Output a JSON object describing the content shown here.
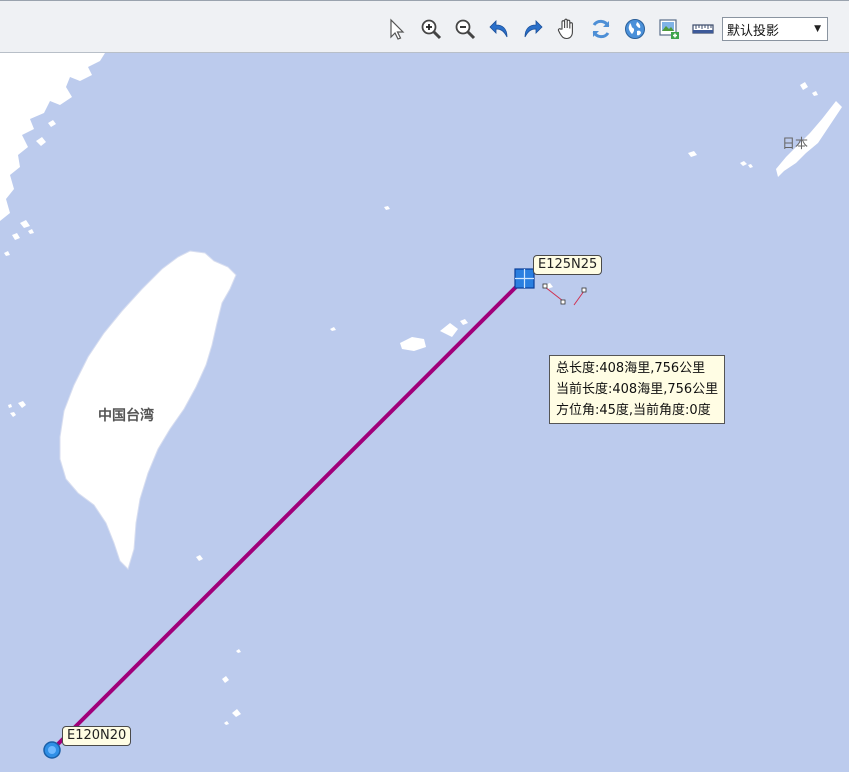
{
  "toolbar": {
    "tools": [
      {
        "name": "select-arrow-icon"
      },
      {
        "name": "zoom-in-icon"
      },
      {
        "name": "zoom-out-icon"
      },
      {
        "name": "undo-icon"
      },
      {
        "name": "redo-icon"
      },
      {
        "name": "pan-hand-icon"
      },
      {
        "name": "refresh-icon"
      },
      {
        "name": "globe-icon"
      },
      {
        "name": "export-image-icon"
      },
      {
        "name": "ruler-icon"
      }
    ],
    "projection": {
      "selected": "默认投影"
    }
  },
  "map": {
    "labels": {
      "taiwan": "中国台湾",
      "japan": "日本"
    },
    "start_tag": "E120N20",
    "end_tag": "E125N25",
    "measure": {
      "total": "总长度:408海里,756公里",
      "current": "当前长度:408海里,756公里",
      "bearing": "方位角:45度,当前角度:0度"
    },
    "colors": {
      "sea": "#bccbed",
      "land": "#ffffff",
      "route": "#a0007a"
    }
  }
}
